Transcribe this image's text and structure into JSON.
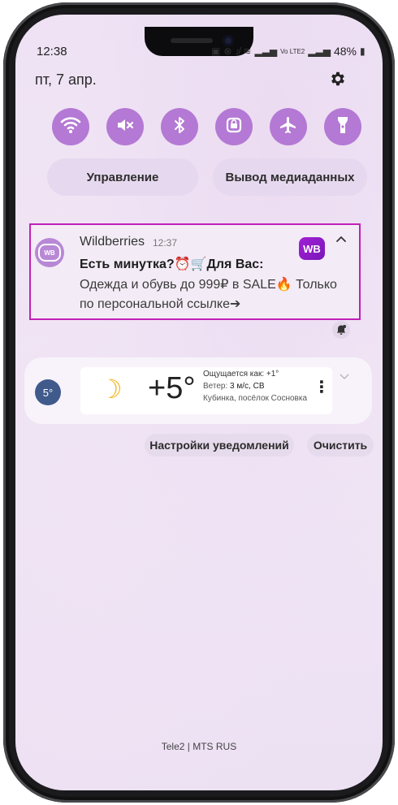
{
  "status_bar": {
    "time": "12:38",
    "battery": "48%"
  },
  "date": "пт, 7 апр.",
  "icons": {
    "wifi": "wifi-icon",
    "mute": "mute-icon",
    "bluetooth": "bluetooth-icon",
    "lock": "rotation-lock-icon",
    "airplane": "airplane-icon",
    "flashlight": "flashlight-icon",
    "settings": "gear-icon"
  },
  "quick_pills": {
    "control": "Управление",
    "media_output": "Вывод медиаданных"
  },
  "notification": {
    "app_icon_label": "WB",
    "app_name": "Wildberries",
    "time": "12:37",
    "badge": "WB",
    "title": "Есть минутка?⏰🛒Для Вас:",
    "body_line1": "Одежда и обувь до 999₽ в SALE🔥 Только",
    "body_line2": "по персональной ссылке➔"
  },
  "weather": {
    "badge_temp": "5°",
    "temperature": "+5°",
    "feels_like": "Ощущается как: +1°",
    "wind_label": "Ветер: ",
    "wind_value": "3 м/с, СВ",
    "location": "Кубинка, посёлок Сосновка"
  },
  "actions": {
    "settings": "Настройки уведомлений",
    "clear": "Очистить"
  },
  "carrier": "Tele2 | MTS RUS",
  "colors": {
    "accent": "#b479d4",
    "wb_purple": "#a11fd6",
    "highlight_border": "#c21fb8"
  }
}
